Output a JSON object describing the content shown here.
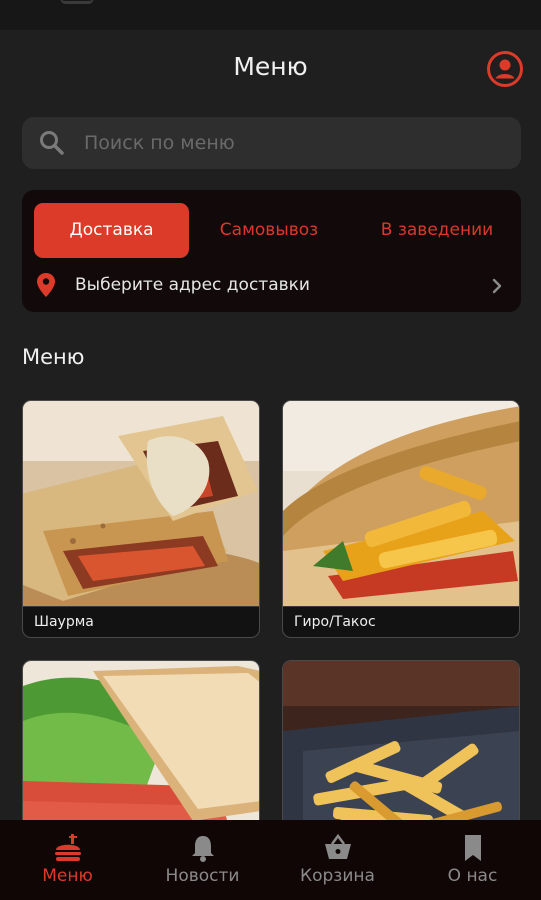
{
  "header": {
    "title": "Меню"
  },
  "search": {
    "placeholder": "Поиск по меню"
  },
  "order_mode": {
    "tabs": [
      {
        "label": "Доставка",
        "active": true
      },
      {
        "label": "Самовывоз",
        "active": false
      },
      {
        "label": "В заведении",
        "active": false
      }
    ],
    "address_label": "Выберите адрес доставки"
  },
  "menu": {
    "section_title": "Меню",
    "categories": [
      {
        "label": "Шаурма"
      },
      {
        "label": "Гиро/Такос"
      },
      {
        "label": ""
      },
      {
        "label": ""
      }
    ]
  },
  "bottom_nav": {
    "items": [
      {
        "label": "Меню",
        "icon": "food-icon",
        "active": true
      },
      {
        "label": "Новости",
        "icon": "bell-icon",
        "active": false
      },
      {
        "label": "Корзина",
        "icon": "basket-icon",
        "active": false
      },
      {
        "label": "О нас",
        "icon": "bookmark-icon",
        "active": false
      }
    ]
  },
  "colors": {
    "accent": "#dc3b2a",
    "background": "#1f1f1f",
    "card": "#120a0a",
    "nav": "#110606"
  }
}
